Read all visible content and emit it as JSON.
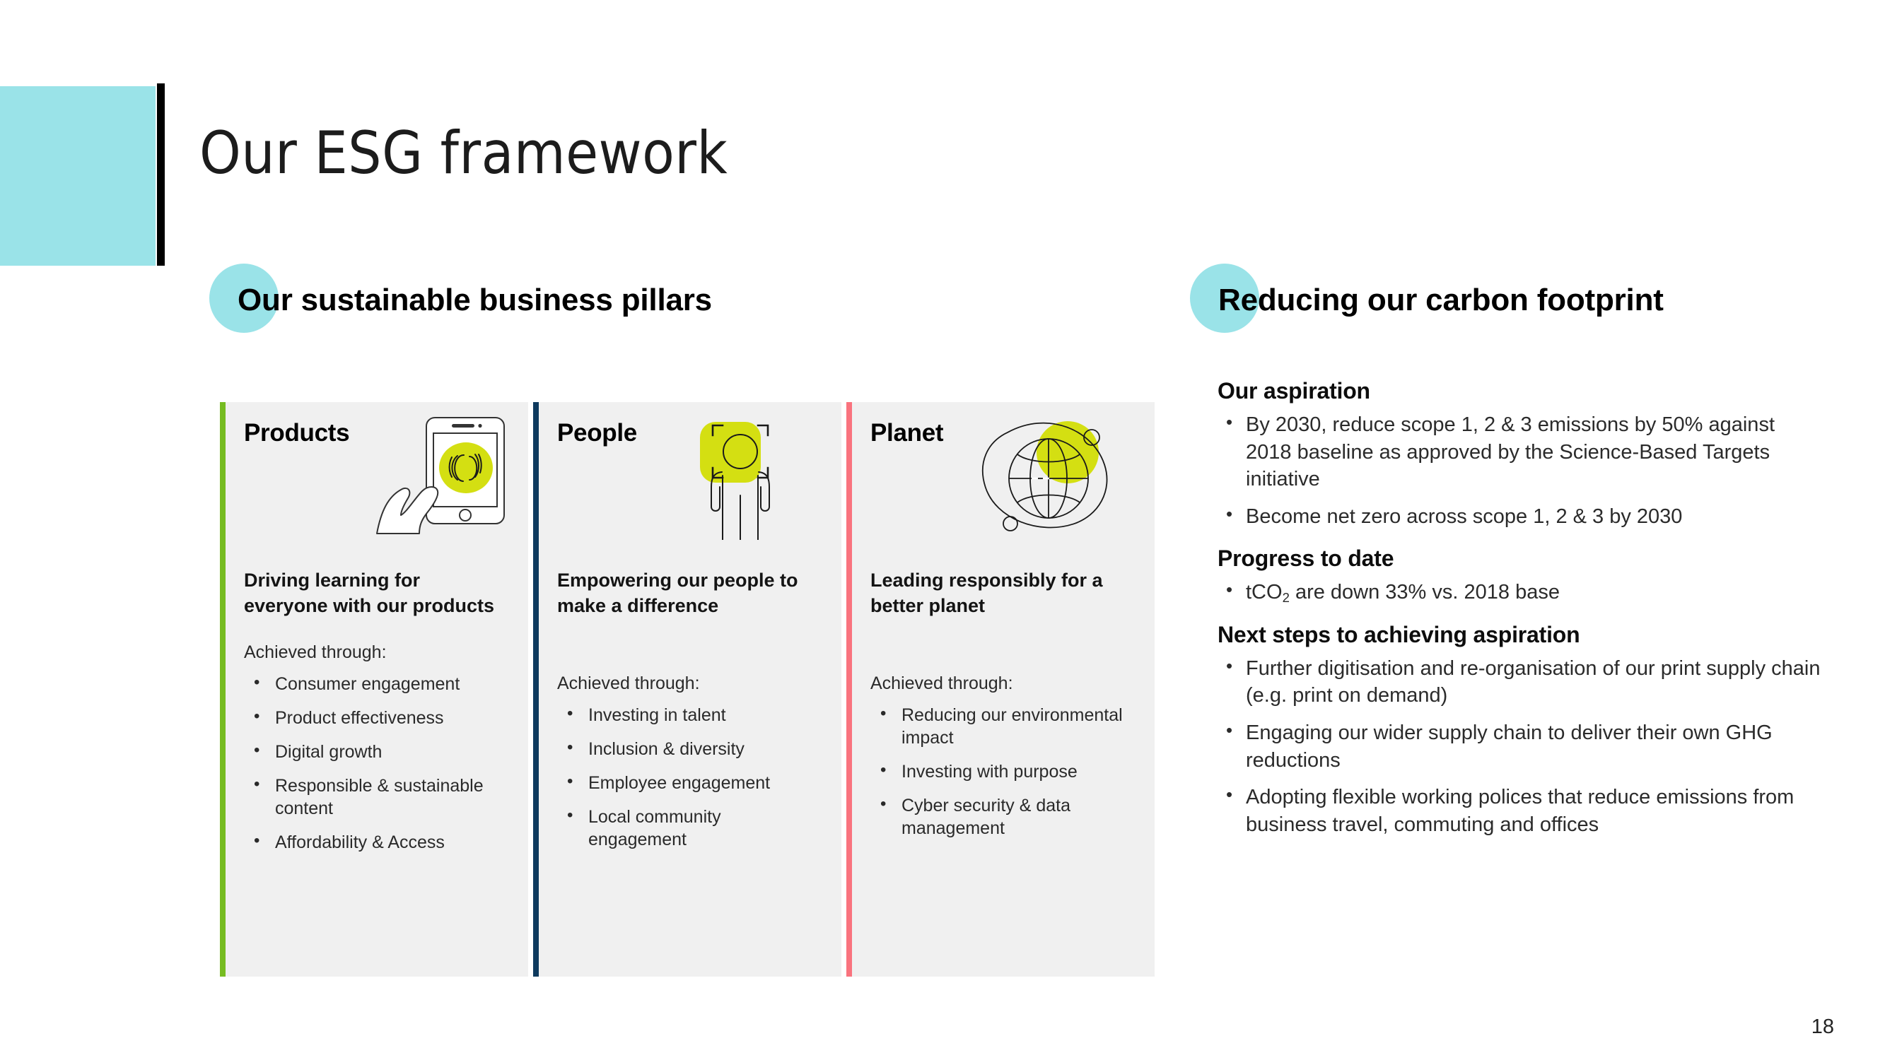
{
  "slide": {
    "title": "Our ESG framework",
    "page_number": "18"
  },
  "colors": {
    "teal": "#9AE3E8",
    "panel_bg": "#F0F0F0",
    "accent_green": "#76BC21",
    "accent_navy": "#0E3A5E",
    "accent_coral": "#F9737E",
    "icon_lime": "#D4DF12",
    "black_bar": "#000000"
  },
  "left_section": {
    "heading": "Our sustainable business pillars",
    "pillars": [
      {
        "title": "Products",
        "icon": "tablet-fingerprint-icon",
        "bar_color": "#76BC21",
        "statement": "Driving learning for everyone with our products",
        "achieved_label": "Achieved through:",
        "bullets": [
          "Consumer engagement",
          "Product effectiveness",
          "Digital growth",
          "Responsible & sustainable content",
          "Affordability & Access"
        ]
      },
      {
        "title": "People",
        "icon": "person-face-scan-icon",
        "bar_color": "#0E3A5E",
        "statement": "Empowering our people to make a difference",
        "achieved_label": "Achieved through:",
        "bullets": [
          "Investing in talent",
          "Inclusion & diversity",
          "Employee engagement",
          "Local community engagement"
        ]
      },
      {
        "title": "Planet",
        "icon": "globe-orbit-icon",
        "bar_color": "#F9737E",
        "statement": "Leading responsibly for a better planet",
        "achieved_label": "Achieved through:",
        "bullets": [
          "Reducing our environmental impact",
          "Investing with purpose",
          "Cyber security & data management"
        ]
      }
    ]
  },
  "right_section": {
    "heading": "Reducing our carbon footprint",
    "blocks": [
      {
        "subhead": "Our aspiration",
        "bullets": [
          "By 2030, reduce scope 1, 2 & 3 emissions by 50% against 2018 baseline as approved by the Science-Based Targets initiative",
          "Become net zero across scope 1, 2 & 3 by 2030"
        ]
      },
      {
        "subhead": "Progress to date",
        "bullets_html": [
          "tCO<sub>2</sub> are down 33% vs. 2018 base"
        ]
      },
      {
        "subhead": "Next steps to achieving aspiration",
        "bullets": [
          "Further digitisation and re-organisation of our print supply chain (e.g. print on demand)",
          "Engaging our wider supply chain to deliver their own GHG reductions",
          "Adopting flexible working polices that reduce emissions from business travel, commuting and offices"
        ]
      }
    ]
  }
}
